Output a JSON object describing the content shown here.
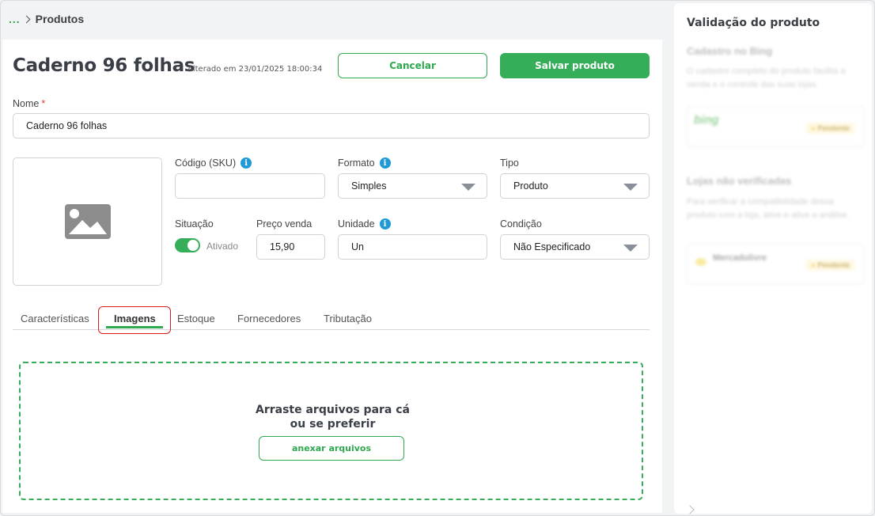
{
  "breadcrumb": {
    "dots": "...",
    "current": "Produtos"
  },
  "product": {
    "title": "Caderno 96 folhas",
    "altered": "Alterado em 23/01/2025 18:00:34"
  },
  "actions": {
    "cancel": "Cancelar",
    "save": "Salvar produto"
  },
  "fields": {
    "nome_label": "Nome",
    "nome_required": "*",
    "nome_value": "Caderno 96 folhas",
    "sku_label": "Código (SKU)",
    "sku_value": "",
    "formato_label": "Formato",
    "formato_value": "Simples",
    "tipo_label": "Tipo",
    "tipo_value": "Produto",
    "situacao_label": "Situação",
    "situacao_value": "Ativado",
    "preco_label": "Preço venda",
    "preco_value": "15,90",
    "unidade_label": "Unidade",
    "unidade_value": "Un",
    "condicao_label": "Condição",
    "condicao_value": "Não Especificado",
    "info_glyph": "i"
  },
  "tabs": [
    {
      "label": "Características"
    },
    {
      "label": "Imagens",
      "active": true
    },
    {
      "label": "Estoque"
    },
    {
      "label": "Fornecedores"
    },
    {
      "label": "Tributação"
    }
  ],
  "dropzone": {
    "line1": "Arraste arquivos para cá",
    "line2": "ou se preferir",
    "button": "anexar arquivos"
  },
  "side": {
    "title": "Validação do produto",
    "section1_title": "Cadastro no Bing",
    "section1_text": "O cadastro completo do produto facilita a venda e o controle das suas lojas.",
    "card1_name": "bing",
    "card1_badge": "Pendente",
    "section2_title": "Lojas não verificadas",
    "section2_text": "Para verificar a compatibilidade dessa produto com a loja, ative e ative a análise.",
    "card2_name": "Mercadolivre",
    "card2_badge": "Pendente"
  },
  "colors": {
    "accent": "#35ad59",
    "info": "#1f9ad6",
    "highlight": "#d9191c"
  },
  "icons": {
    "image_placeholder": "image-icon",
    "dropdown": "caret-down-icon"
  }
}
